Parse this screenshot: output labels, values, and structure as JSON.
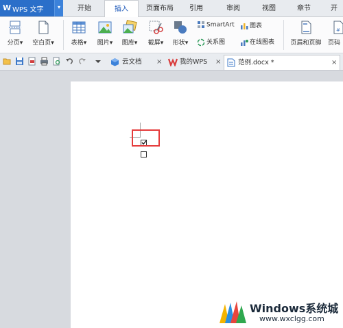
{
  "app": {
    "logo": "W",
    "name": "WPS 文字",
    "dropdown": "▾"
  },
  "menu_tabs": [
    "开始",
    "插入",
    "页面布局",
    "引用",
    "审阅",
    "视图",
    "章节",
    "开"
  ],
  "ribbon": {
    "page_break": "分页",
    "blank_page": "空白页",
    "table": "表格",
    "picture": "图片",
    "gallery": "图库",
    "screenshot": "截屏",
    "shapes": "形状",
    "smartart": "SmartArt",
    "relationship": "关系图",
    "chart": "图表",
    "online_chart": "在线图表",
    "header_footer": "页眉和页脚",
    "page_number": "页码"
  },
  "doc_tabs": [
    {
      "label": "云文档",
      "close": "×"
    },
    {
      "label": "我的WPS",
      "close": "×"
    },
    {
      "label": "范例.docx *",
      "close": "×"
    }
  ],
  "watermark": {
    "title": "Windows系统城",
    "url": "www.wxclgg.com"
  },
  "colors": {
    "accent": "#2b6fc9",
    "highlight": "#e53b3b"
  }
}
